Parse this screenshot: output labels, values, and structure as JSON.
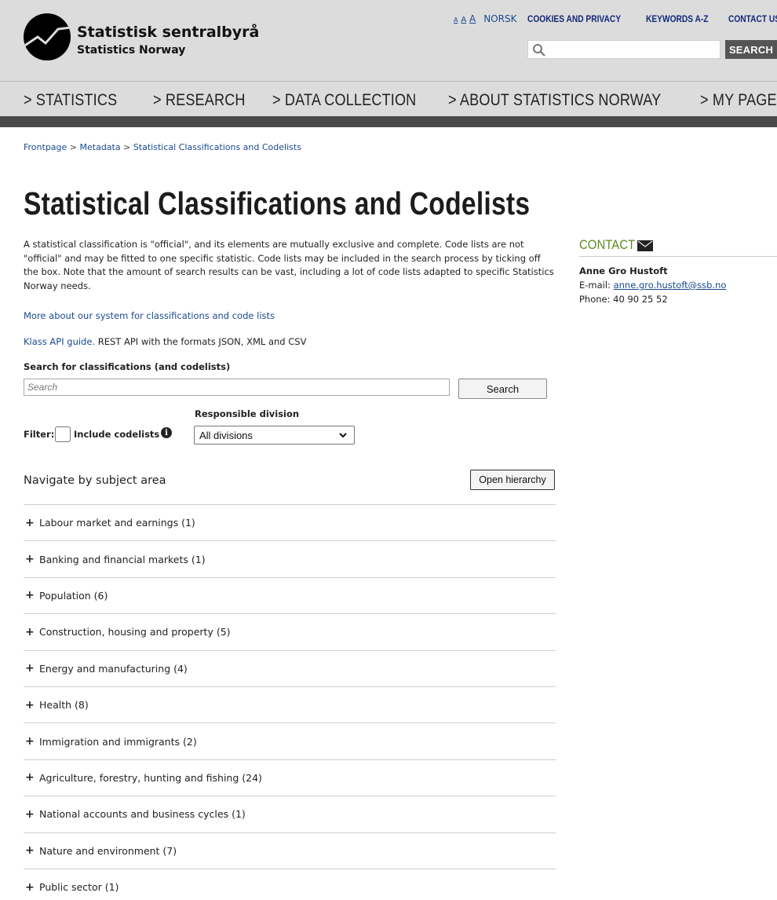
{
  "header": {
    "logo_line1": "Statistisk sentralbyrå",
    "logo_line2": "Statistics Norway",
    "text_size_small": "A",
    "text_size_medium": "A",
    "text_size_large": "A",
    "toplinks": {
      "norsk": "NORSK",
      "cookies": "COOKIES AND PRIVACY",
      "keywords": "KEYWORDS A-Z",
      "contact": "CONTACT US"
    },
    "search_button": "SEARCH",
    "nav": [
      "> STATISTICS",
      "> RESEARCH",
      "> DATA COLLECTION",
      "> ABOUT STATISTICS NORWAY",
      "> MY PAGE"
    ]
  },
  "breadcrumb": {
    "frontpage": "Frontpage",
    "sep": ">",
    "metadata": "Metadata",
    "current": "Statistical Classifications and Codelists"
  },
  "page": {
    "title": "Statistical Classifications and Codelists",
    "intro": "A statistical classification is \"official\", and its elements are mutually exclusive and complete. Code lists are not \"official\" and may be fitted to one specific statistic. Code lists may be included in the search process by ticking off the box. Note that the amount of search results can be vast, including a lot of code lists adapted to specific Statistics Norway needs.",
    "more_link": "More about our system for classifications and code lists",
    "api_link": "Klass API guide.",
    "api_rest": " REST API with the formats JSON, XML and CSV"
  },
  "search": {
    "label": "Search for classifications (and codelists)",
    "placeholder": "Search",
    "value": "",
    "button": "Search",
    "responsible_label": "Responsible division",
    "filter_label": "Filter:",
    "include_codelists": "Include codelists",
    "include_codelists_checked": false,
    "division_selected": "All divisions"
  },
  "subjects": {
    "heading": "Navigate by subject area",
    "open_hierarchy": "Open hierarchy",
    "items": [
      "Labour market and earnings (1)",
      "Banking and financial markets (1)",
      "Population (6)",
      "Construction, housing and property (5)",
      "Energy and manufacturing (4)",
      "Health (8)",
      "Immigration and immigrants (2)",
      "Agriculture, forestry, hunting and fishing (24)",
      "National accounts and business cycles (1)",
      "Nature and environment (7)",
      "Public sector (1)"
    ]
  },
  "contact": {
    "title": "CONTACT",
    "name": "Anne Gro Hustoft",
    "email_label": "E-mail: ",
    "email": "anne.gro.hustoft@ssb.no",
    "phone": "Phone: 40 90 25 52"
  },
  "colors": {
    "header_bg": "#dcdcdc",
    "nav_dark_bar": "#4a4a4a",
    "link": "#1a4a8f",
    "contact_green": "#5d8a1e"
  }
}
